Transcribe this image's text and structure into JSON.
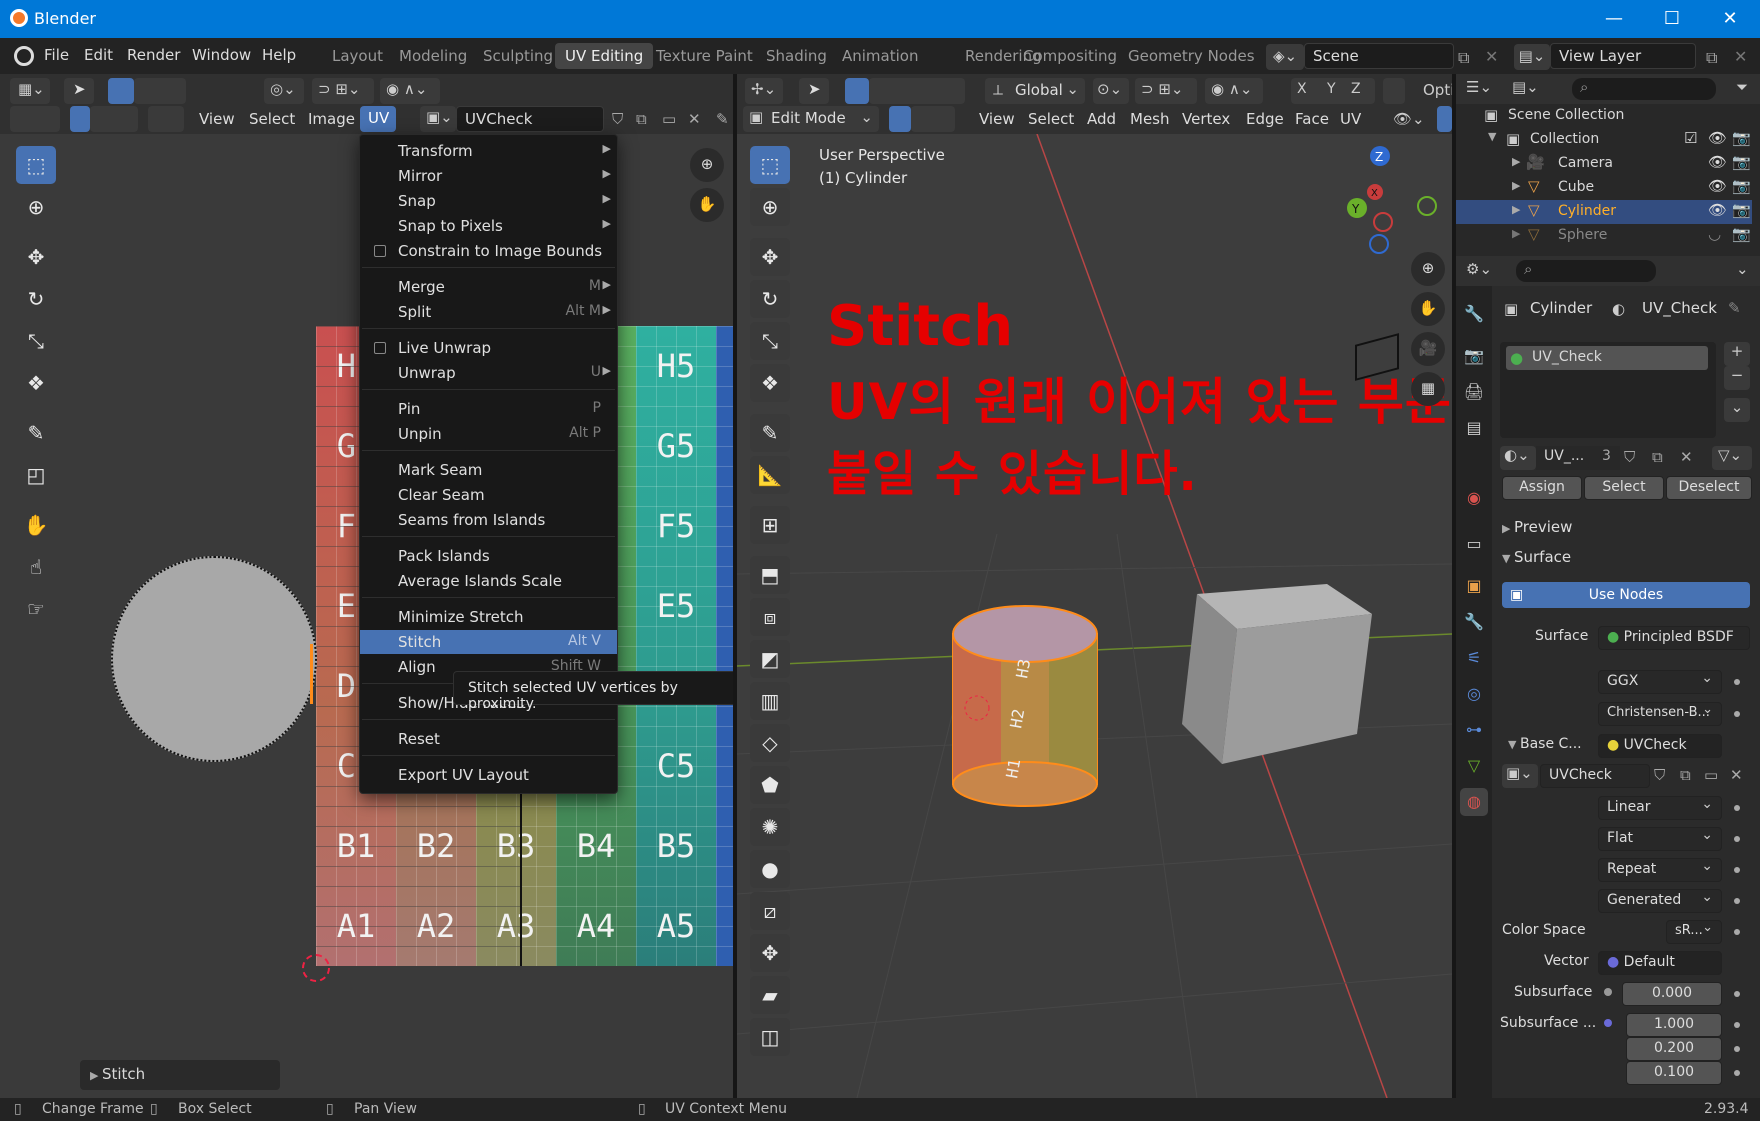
{
  "window": {
    "title": "Blender",
    "minimize": "—",
    "maximize": "☐",
    "close": "✕"
  },
  "menubar": {
    "items": [
      "File",
      "Edit",
      "Render",
      "Window",
      "Help"
    ],
    "workspaces": [
      "Layout",
      "Modeling",
      "Sculpting",
      "UV Editing",
      "Texture Paint",
      "Shading",
      "Animation",
      "Rendering",
      "Compositing",
      "Geometry Nodes"
    ],
    "active_workspace": "UV Editing",
    "scene": "Scene",
    "view_layer": "View Layer"
  },
  "uv_editor": {
    "menus": [
      "View",
      "Select",
      "Image",
      "UV"
    ],
    "image_name": "UVCheck",
    "grid_rows": [
      "H",
      "G",
      "F",
      "E",
      "D",
      "C",
      "B",
      "A"
    ],
    "grid_cols": [
      "1",
      "2",
      "3",
      "4",
      "5"
    ],
    "operator_panel": "Stitch"
  },
  "uv_menu": {
    "items": [
      {
        "label": "Transform",
        "shortcut": "",
        "submenu": true
      },
      {
        "label": "Mirror",
        "shortcut": "",
        "submenu": true
      },
      {
        "label": "Snap",
        "shortcut": "",
        "submenu": true
      },
      {
        "label": "Snap to Pixels",
        "shortcut": "",
        "submenu": true
      },
      {
        "label": "Constrain to Image Bounds",
        "checkbox": true
      },
      {
        "label": "Merge",
        "shortcut": "M",
        "submenu": true
      },
      {
        "label": "Split",
        "shortcut": "Alt M",
        "submenu": true
      },
      {
        "label": "Live Unwrap",
        "checkbox": true
      },
      {
        "label": "Unwrap",
        "shortcut": "U",
        "submenu": true
      },
      {
        "label": "Pin",
        "shortcut": "P"
      },
      {
        "label": "Unpin",
        "shortcut": "Alt P"
      },
      {
        "label": "Mark Seam"
      },
      {
        "label": "Clear Seam"
      },
      {
        "label": "Seams from Islands"
      },
      {
        "label": "Pack Islands"
      },
      {
        "label": "Average Islands Scale"
      },
      {
        "label": "Minimize Stretch"
      },
      {
        "label": "Stitch",
        "shortcut": "Alt V"
      },
      {
        "label": "Align",
        "shortcut": "Shift W"
      },
      {
        "label": "Show/Hide Faces"
      },
      {
        "label": "Reset"
      },
      {
        "label": "Export UV Layout"
      }
    ],
    "tooltip": "Stitch selected UV vertices by proximity."
  },
  "viewport": {
    "mode": "Edit Mode",
    "orientation": "Global",
    "menus": [
      "View",
      "Select",
      "Add",
      "Mesh",
      "Vertex",
      "Edge",
      "Face",
      "UV"
    ],
    "options": "Opti",
    "perspective": "User Perspective",
    "object": "(1) Cylinder",
    "overlay_title": "Stitch",
    "overlay_line1": "UV의 원래 이어져 있는 부분에",
    "overlay_line2": "붙일 수 있습니다.",
    "gizmo": {
      "x": "X",
      "y": "Y",
      "z": "Z"
    }
  },
  "outliner": {
    "root": "Scene Collection",
    "collection": "Collection",
    "objects": [
      "Camera",
      "Cube",
      "Cylinder",
      "Sphere"
    ],
    "active": "Cylinder"
  },
  "properties": {
    "object": "Cylinder",
    "material": "UV_Check",
    "slot": "UV_Check",
    "mat_short": "UV_...",
    "users": "3",
    "assign": "Assign",
    "select": "Select",
    "deselect": "Deselect",
    "preview": "Preview",
    "surface_panel": "Surface",
    "use_nodes": "Use Nodes",
    "surface_label": "Surface",
    "surface_value": "Principled BSDF",
    "distribution": "GGX",
    "subsurface_method": "Christensen-B...",
    "base_color_label": "Base C...",
    "base_color_value": "UVCheck",
    "image": "UVCheck",
    "interp": "Linear",
    "proj": "Flat",
    "ext": "Repeat",
    "source": "Generated",
    "colorspace_label": "Color Space",
    "colorspace_value": "sR...",
    "vector_label": "Vector",
    "vector_value": "Default",
    "subsurface_label": "Subsurface",
    "subsurface_value": "0.000",
    "subsurface_radius_label": "Subsurface ...",
    "radius": [
      "1.000",
      "0.200",
      "0.100"
    ]
  },
  "status": {
    "left": "Change Frame",
    "mid1": "Box Select",
    "mid2": "Pan View",
    "ctx": "UV Context Menu",
    "version": "2.93.4"
  },
  "colors": {
    "accent": "#4772b3",
    "overlay_red": "#e60000",
    "title_blue": "#0078d7",
    "select_orange": "#ff8c1a"
  }
}
